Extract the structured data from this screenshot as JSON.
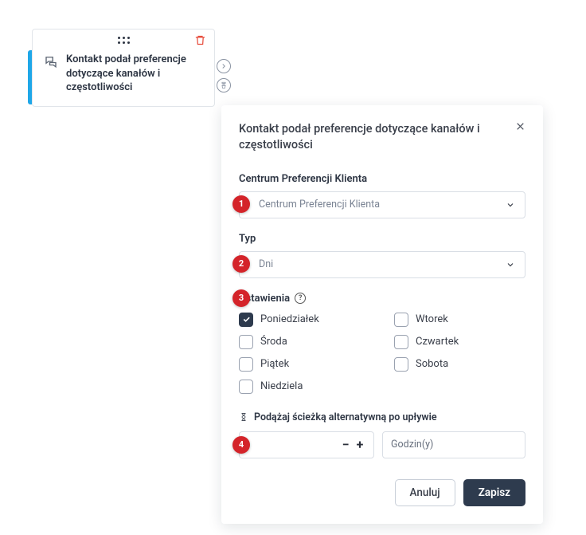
{
  "node": {
    "title": "Kontakt podał preferencje dotyczące kanałów i częstotliwości"
  },
  "panel": {
    "title": "Kontakt podał preferencje dotyczące kanałów i częstotliwości",
    "field1": {
      "label": "Centrum Preferencji Klienta",
      "value": "Centrum Preferencji Klienta",
      "badge": "1"
    },
    "field2": {
      "label": "Typ",
      "value": "Dni",
      "badge": "2"
    },
    "settings": {
      "label": "Ustawienia",
      "badge": "3",
      "days": [
        {
          "label": "Poniedziałek",
          "checked": true
        },
        {
          "label": "Wtorek",
          "checked": false
        },
        {
          "label": "Środa",
          "checked": false
        },
        {
          "label": "Czwartek",
          "checked": false
        },
        {
          "label": "Piątek",
          "checked": false
        },
        {
          "label": "Sobota",
          "checked": false
        },
        {
          "label": "Niedziela",
          "checked": false
        }
      ]
    },
    "altPath": {
      "label": "Podążaj ścieżką alternatywną po upływie",
      "badge": "4",
      "stepValue": "",
      "unit": "Godzin(y)"
    },
    "buttons": {
      "cancel": "Anuluj",
      "save": "Zapisz"
    }
  }
}
